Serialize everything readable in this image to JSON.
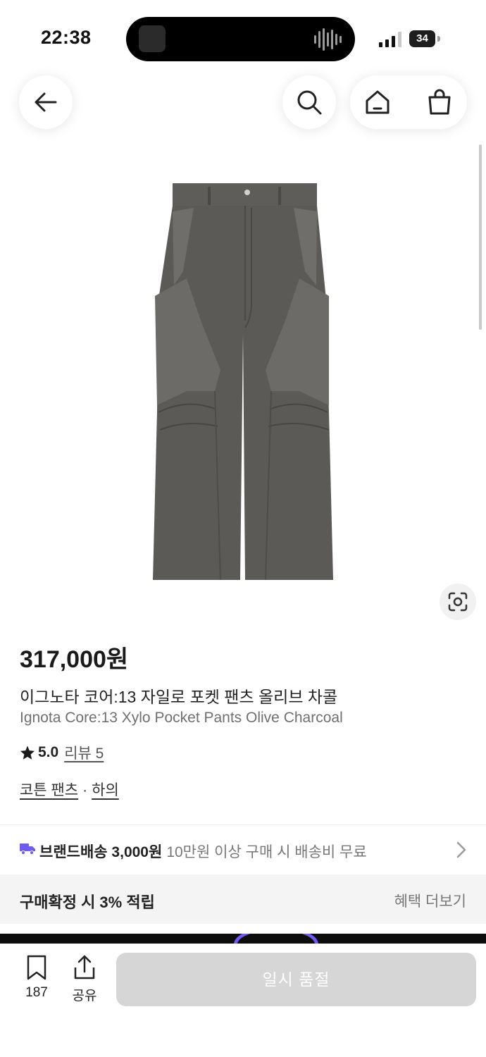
{
  "status_bar": {
    "time": "22:38",
    "battery": "34"
  },
  "product": {
    "price": "317,000원",
    "name_ko": "이그노타 코어:13 자일로 포켓 팬츠 올리브 차콜",
    "name_en": "Ignota Core:13 Xylo Pocket Pants Olive Charcoal",
    "rating": "5.0",
    "review_label": "리뷰 5",
    "category_1": "코튼 팬츠",
    "category_sep": "·",
    "category_2": "하의"
  },
  "shipping": {
    "label": "브랜드배송 3,000원",
    "note": "10만원 이상 구매 시 배송비 무료"
  },
  "benefit": {
    "label": "구매확정 시 3% 적립",
    "more": "혜택 더보기"
  },
  "bottom_bar": {
    "bookmark_count": "187",
    "share_label": "공유",
    "sold_out_label": "일시 품절"
  },
  "colors": {
    "accent_purple": "#6e5cf0",
    "soldout_bg": "#d6d6d6",
    "pants": "#5b5a57"
  },
  "icons": [
    "back-arrow-icon",
    "search-icon",
    "home-icon",
    "shopping-bag-icon",
    "lens-search-icon",
    "star-icon",
    "truck-icon",
    "chevron-right-icon",
    "bookmark-icon",
    "share-icon"
  ]
}
